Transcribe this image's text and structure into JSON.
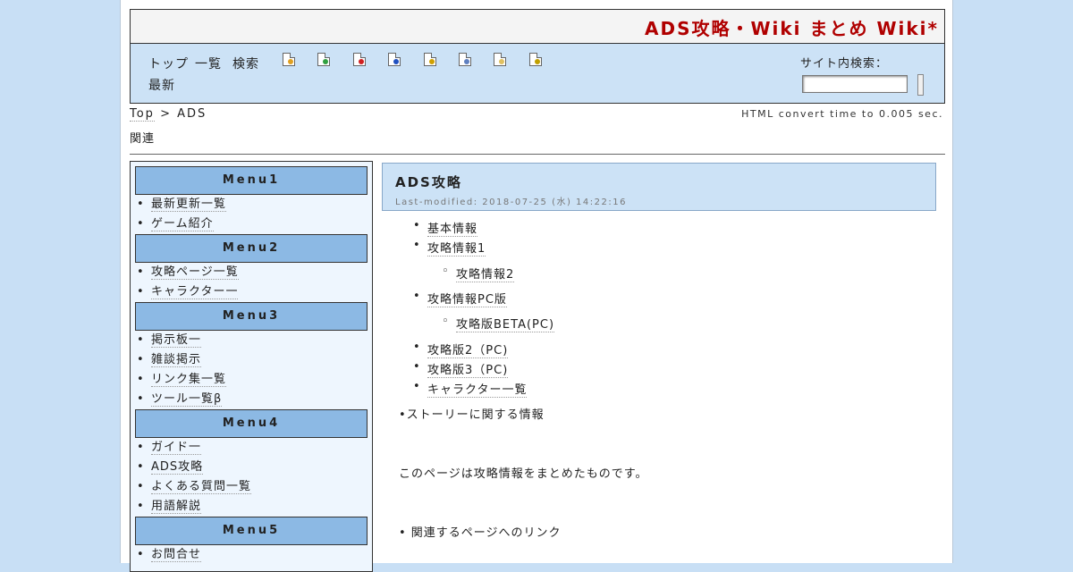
{
  "site": {
    "title": "ADS攻略・Wiki まとめ Wiki*"
  },
  "toolbar": {
    "nav": [
      "トップ",
      "一覧",
      "検索",
      "最新"
    ],
    "icons": [
      {
        "name": "new-page-icon",
        "color": "#e0a020"
      },
      {
        "name": "edit-page-icon",
        "color": "#30a040"
      },
      {
        "name": "diff-icon",
        "color": "#d02020"
      },
      {
        "name": "backup-icon",
        "color": "#2050c0"
      },
      {
        "name": "freeze-icon",
        "color": "#d0a000"
      },
      {
        "name": "copy-icon",
        "color": "#6080c0"
      },
      {
        "name": "list-icon",
        "color": "#e0c060"
      },
      {
        "name": "help-icon",
        "color": "#c0a000"
      }
    ],
    "search_label": "サイト内検索："
  },
  "breadcrumb": {
    "top": "Top",
    "separator": ">",
    "current": "ADS"
  },
  "convert_time": "HTML convert time to 0.005 sec.",
  "related": "関連",
  "sidebar": {
    "menus": [
      {
        "title": "Menu1",
        "items": [
          "最新更新一覧",
          "ゲーム紹介"
        ]
      },
      {
        "title": "Menu2",
        "items": [
          "攻略ページ一覧",
          "キャラクター一"
        ]
      },
      {
        "title": "Menu3",
        "items": [
          "掲示板一",
          "雑談掲示",
          "リンク集一覧",
          "ツール一覧β"
        ]
      },
      {
        "title": "Menu4",
        "items": [
          "ガイド一",
          "ADS攻略",
          "よくある質問一覧",
          "用語解説"
        ]
      },
      {
        "title": "Menu5",
        "items": [
          "お問合せ"
        ]
      }
    ]
  },
  "main": {
    "title": "ADS攻略",
    "last_modified": "Last-modified: 2018-07-25 (水) 14:22:16",
    "items": [
      {
        "text": "基本情報",
        "style": "bullet"
      },
      {
        "text": "攻略情報1",
        "style": "bullet"
      },
      {
        "text": "攻略情報2",
        "style": "circle"
      },
      {
        "text": "攻略情報PC版",
        "style": "bullet"
      },
      {
        "text": "攻略版BETA(PC)",
        "style": "circle"
      },
      {
        "text": "攻略版2（PC)",
        "style": "bullet"
      },
      {
        "text": "攻略版3（PC)",
        "style": "bullet"
      },
      {
        "text": "キャラクター一覧",
        "style": "bullet"
      },
      {
        "text": "•ストーリーに関する情報",
        "style": "plain"
      },
      {
        "text": "このページは攻略情報をまとめたものです。",
        "style": "plain"
      },
      {
        "text": "•  関連するページへのリンク",
        "style": "plain"
      }
    ]
  }
}
